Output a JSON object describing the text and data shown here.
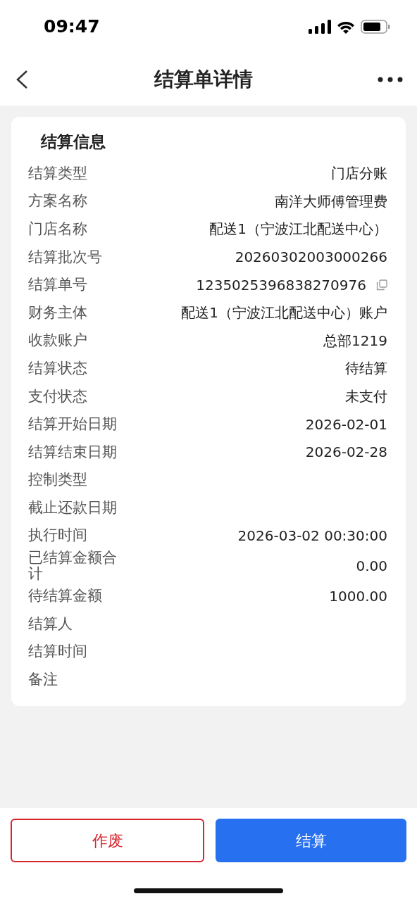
{
  "status_bar": {
    "time": "09:47"
  },
  "header": {
    "title": "结算单详情"
  },
  "card": {
    "title": "结算信息",
    "rows": [
      {
        "label": "结算类型",
        "value": "门店分账",
        "kind": "plain"
      },
      {
        "label": "方案名称",
        "value": "南洋大师傅管理费",
        "kind": "plain"
      },
      {
        "label": "门店名称",
        "value": "配送1（宁波江北配送中心）",
        "kind": "plain"
      },
      {
        "label": "结算批次号",
        "value": "20260302003000266",
        "kind": "plain"
      },
      {
        "label": "结算单号",
        "value": "1235025396838270976",
        "kind": "copyable"
      },
      {
        "label": "财务主体",
        "value": "配送1（宁波江北配送中心）账户",
        "kind": "plain"
      },
      {
        "label": "收款账户",
        "value": "总部1219",
        "kind": "plain"
      },
      {
        "label": "结算状态",
        "value": "待结算",
        "kind": "plain"
      },
      {
        "label": "支付状态",
        "value": "未支付",
        "kind": "plain"
      },
      {
        "label": "结算开始日期",
        "value": "2026-02-01",
        "kind": "plain"
      },
      {
        "label": "结算结束日期",
        "value": "2026-02-28",
        "kind": "plain"
      },
      {
        "label": "控制类型",
        "kind": "plain"
      },
      {
        "label": "截止还款日期",
        "kind": "plain"
      },
      {
        "label": "执行时间",
        "value": "2026-03-02 00:30:00",
        "kind": "plain"
      },
      {
        "label": "已结算金额合计",
        "value": "0.00",
        "kind": "plain"
      },
      {
        "label": "待结算金额",
        "value": "1000.00",
        "kind": "plain"
      },
      {
        "label": "结算人",
        "kind": "plain"
      },
      {
        "label": "结算时间",
        "kind": "plain"
      },
      {
        "label": "备注",
        "kind": "plain"
      }
    ]
  },
  "buttons": [
    {
      "label": "作废",
      "kind": "outline-danger"
    },
    {
      "label": "结算",
      "kind": "primary"
    }
  ]
}
